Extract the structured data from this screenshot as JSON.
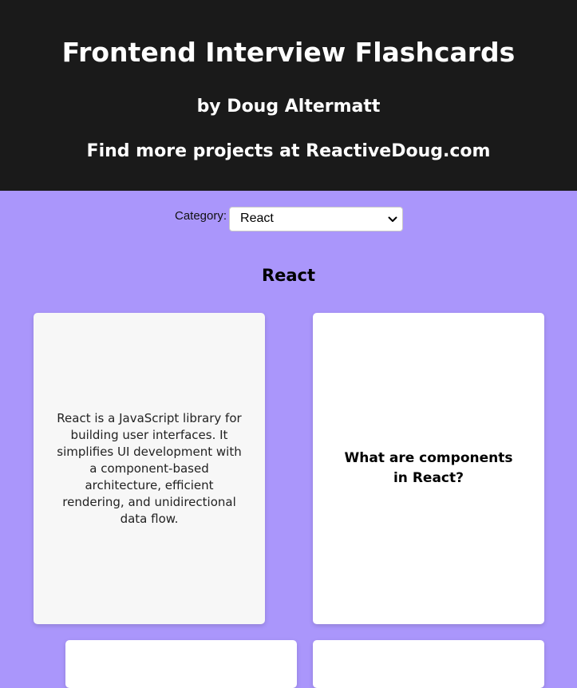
{
  "header": {
    "title": "Frontend Interview Flashcards",
    "byline": "by Doug Altermatt",
    "more": "Find more projects at ReactiveDoug.com"
  },
  "filter": {
    "label": "Category:",
    "selected": "React"
  },
  "section": {
    "title": "React"
  },
  "cards": [
    {
      "side": "answer",
      "text": "React is a JavaScript library for building user interfaces. It simplifies UI development with a component-based architecture, efficient rendering, and unidirectional data flow."
    },
    {
      "side": "question",
      "text": "What are components in React?"
    },
    {
      "side": "question",
      "text": ""
    },
    {
      "side": "question",
      "text": ""
    }
  ],
  "colors": {
    "background": "#aa96fb",
    "header": "#1a1a1a",
    "card": "#ffffff",
    "card_flipped": "#f7f7f7"
  },
  "icons": {
    "select_arrow": "chevron-down-icon"
  }
}
